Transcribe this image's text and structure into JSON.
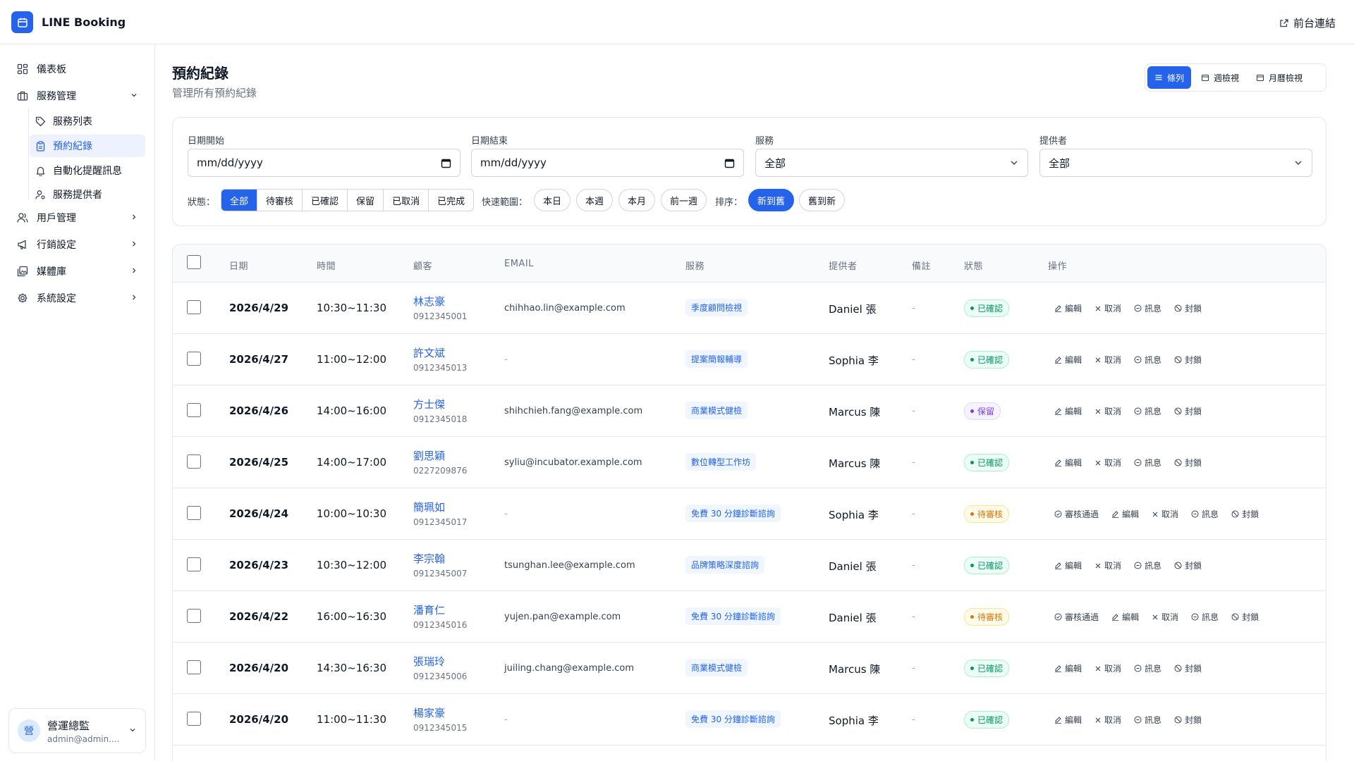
{
  "app": {
    "name": "LINE Booking",
    "front_link": "前台連結"
  },
  "sidebar": {
    "dashboard": "儀表板",
    "service_mgmt": "服務管理",
    "sub": [
      "服務列表",
      "預約紀錄",
      "自動化提醒訊息",
      "服務提供者"
    ],
    "user_mgmt": "用戶管理",
    "marketing": "行銷設定",
    "media": "媒體庫",
    "system": "系統設定",
    "user": {
      "avatar": "營",
      "name": "營運總監",
      "email": "admin@admin...."
    }
  },
  "page": {
    "title": "預約紀錄",
    "subtitle": "管理所有預約紀錄"
  },
  "views": [
    "條列",
    "週檢視",
    "月曆檢視"
  ],
  "filters": {
    "date_start_label": "日期開始",
    "date_start_value": "mm/dd/yyyy",
    "date_end_label": "日期結束",
    "date_end_value": "mm/dd/yyyy",
    "service_label": "服務",
    "service_value": "全部",
    "provider_label": "提供者",
    "provider_value": "全部",
    "status_label": "狀態：",
    "status_options": [
      "全部",
      "待審核",
      "已確認",
      "保留",
      "已取消",
      "已完成"
    ],
    "range_label": "快速範圍：",
    "range_options": [
      "本日",
      "本週",
      "本月",
      "前一週"
    ],
    "sort_label": "排序：",
    "sort_options": [
      "新到舊",
      "舊到新"
    ]
  },
  "table": {
    "headers": [
      "日期",
      "時間",
      "顧客",
      "EMAIL",
      "服務",
      "提供者",
      "備註",
      "狀態",
      "操作"
    ],
    "action_labels": {
      "approve": "審核通過",
      "edit": "編輯",
      "cancel": "取消",
      "message": "訊息",
      "block": "封鎖"
    },
    "rows": [
      {
        "date": "2026/4/29",
        "time": "10:30~11:30",
        "name": "林志豪",
        "phone": "0912345001",
        "email": "chihhao.lin@example.com",
        "service": "季度顧問檢視",
        "provider": "Daniel 張",
        "note": "-",
        "status": "已確認",
        "status_key": "confirmed"
      },
      {
        "date": "2026/4/27",
        "time": "11:00~12:00",
        "name": "許文斌",
        "phone": "0912345013",
        "email": "-",
        "service": "提案簡報輔導",
        "provider": "Sophia 李",
        "note": "-",
        "status": "已確認",
        "status_key": "confirmed"
      },
      {
        "date": "2026/4/26",
        "time": "14:00~16:00",
        "name": "方士傑",
        "phone": "0912345018",
        "email": "shihchieh.fang@example.com",
        "service": "商業模式健檢",
        "provider": "Marcus 陳",
        "note": "-",
        "status": "保留",
        "status_key": "hold"
      },
      {
        "date": "2026/4/25",
        "time": "14:00~17:00",
        "name": "劉思穎",
        "phone": "0227209876",
        "email": "syliu@incubator.example.com",
        "service": "數位轉型工作坊",
        "provider": "Marcus 陳",
        "note": "-",
        "status": "已確認",
        "status_key": "confirmed"
      },
      {
        "date": "2026/4/24",
        "time": "10:00~10:30",
        "name": "簡珮如",
        "phone": "0912345017",
        "email": "-",
        "service": "免費 30 分鐘診斷諮詢",
        "provider": "Sophia 李",
        "note": "-",
        "status": "待審核",
        "status_key": "pending"
      },
      {
        "date": "2026/4/23",
        "time": "10:30~12:00",
        "name": "李宗翰",
        "phone": "0912345007",
        "email": "tsunghan.lee@example.com",
        "service": "品牌策略深度諮詢",
        "provider": "Daniel 張",
        "note": "-",
        "status": "已確認",
        "status_key": "confirmed"
      },
      {
        "date": "2026/4/22",
        "time": "16:00~16:30",
        "name": "潘育仁",
        "phone": "0912345016",
        "email": "yujen.pan@example.com",
        "service": "免費 30 分鐘診斷諮詢",
        "provider": "Daniel 張",
        "note": "-",
        "status": "待審核",
        "status_key": "pending"
      },
      {
        "date": "2026/4/20",
        "time": "14:30~16:30",
        "name": "張瑞玲",
        "phone": "0912345006",
        "email": "juiling.chang@example.com",
        "service": "商業模式健檢",
        "provider": "Marcus 陳",
        "note": "-",
        "status": "已確認",
        "status_key": "confirmed"
      },
      {
        "date": "2026/4/20",
        "time": "11:00~11:30",
        "name": "楊家豪",
        "phone": "0912345015",
        "email": "-",
        "service": "免費 30 分鐘診斷諮詢",
        "provider": "Sophia 李",
        "note": "-",
        "status": "已確認",
        "status_key": "confirmed"
      }
    ]
  }
}
